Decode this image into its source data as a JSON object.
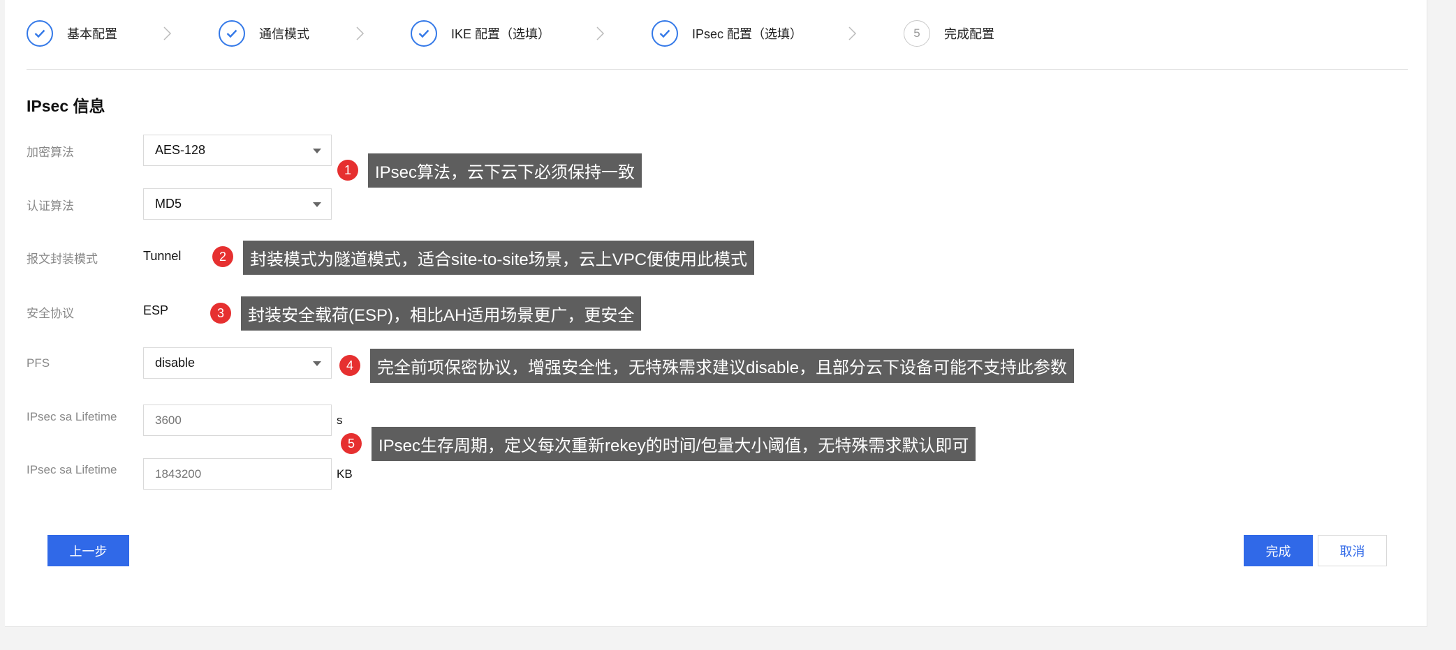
{
  "steps": [
    {
      "label": "基本配置",
      "status": "done"
    },
    {
      "label": "通信模式",
      "status": "done"
    },
    {
      "label": "IKE 配置（选填）",
      "status": "done"
    },
    {
      "label": "IPsec 配置（选填）",
      "status": "done"
    },
    {
      "label": "完成配置",
      "status": "pending",
      "number": "5"
    }
  ],
  "section_title": "IPsec 信息",
  "form": {
    "encryption": {
      "label": "加密算法",
      "value": "AES-128"
    },
    "auth": {
      "label": "认证算法",
      "value": "MD5"
    },
    "encap_mode": {
      "label": "报文封装模式",
      "value": "Tunnel"
    },
    "protocol": {
      "label": "安全协议",
      "value": "ESP"
    },
    "pfs": {
      "label": "PFS",
      "value": "disable"
    },
    "lifetime_s": {
      "label": "IPsec sa Lifetime",
      "placeholder": "3600",
      "unit": "s"
    },
    "lifetime_kb": {
      "label": "IPsec sa Lifetime",
      "placeholder": "1843200",
      "unit": "KB"
    }
  },
  "annotations": [
    {
      "number": "1",
      "text": "IPsec算法，云下云下必须保持一致"
    },
    {
      "number": "2",
      "text": "封装模式为隧道模式，适合site-to-site场景，云上VPC便使用此模式"
    },
    {
      "number": "3",
      "text": "封装安全载荷(ESP)，相比AH适用场景更广，更安全"
    },
    {
      "number": "4",
      "text": "完全前项保密协议，增强安全性，无特殊需求建议disable，且部分云下设备可能不支持此参数"
    },
    {
      "number": "5",
      "text": "IPsec生存周期，定义每次重新rekey的时间/包量大小阈值，无特殊需求默认即可"
    }
  ],
  "buttons": {
    "prev": "上一步",
    "finish": "完成",
    "cancel": "取消"
  },
  "colors": {
    "primary": "#3069e8",
    "annotation_badge": "#e63030",
    "annotation_bg": "#5e5e5e"
  }
}
